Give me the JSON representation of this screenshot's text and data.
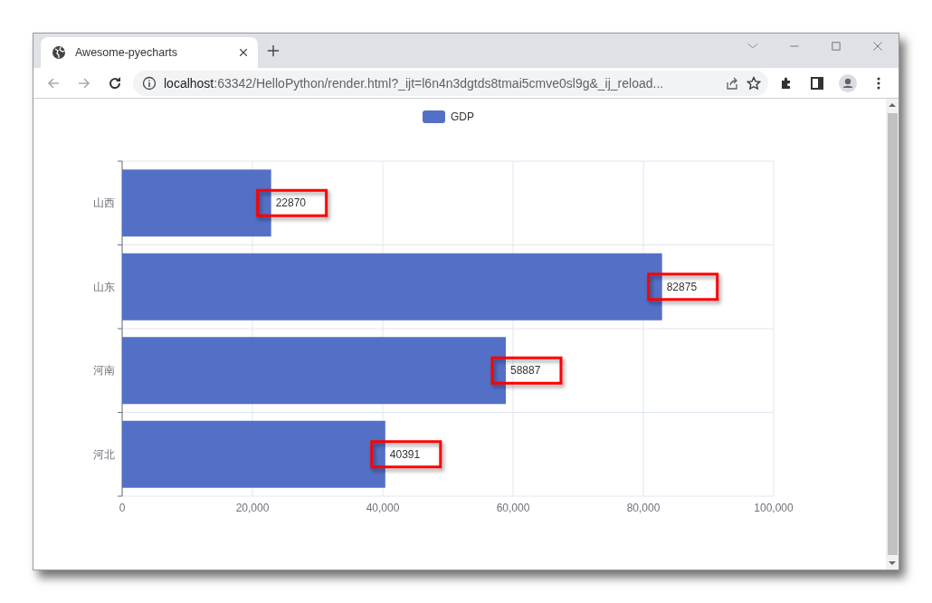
{
  "browser": {
    "tabs": [
      {
        "title": "Awesome-pyecharts",
        "selected": true
      }
    ],
    "url": {
      "host": "localhost",
      "rest": ":63342/HelloPython/render.html?_ijt=l6n4n3dgtds8tmai5cmve0sl9g&_ij_reload..."
    }
  },
  "chart_data": {
    "type": "bar",
    "orientation": "horizontal",
    "categories": [
      "山西",
      "山东",
      "河南",
      "河北"
    ],
    "series": [
      {
        "name": "GDP",
        "color": "#5470c6",
        "values": [
          22870,
          82875,
          58887,
          40391
        ]
      }
    ],
    "grid": true,
    "xlim": [
      0,
      100000
    ],
    "xticks": [
      {
        "value": 0,
        "label": "0"
      },
      {
        "value": 20000,
        "label": "20,000"
      },
      {
        "value": 40000,
        "label": "40,000"
      },
      {
        "value": 60000,
        "label": "60,000"
      },
      {
        "value": 80000,
        "label": "80,000"
      },
      {
        "value": 100000,
        "label": "100,000"
      }
    ],
    "data_labels": true
  },
  "label_highlights": [
    {
      "kind": "box"
    },
    {
      "kind": "box"
    },
    {
      "kind": "box"
    },
    {
      "kind": "box"
    }
  ]
}
